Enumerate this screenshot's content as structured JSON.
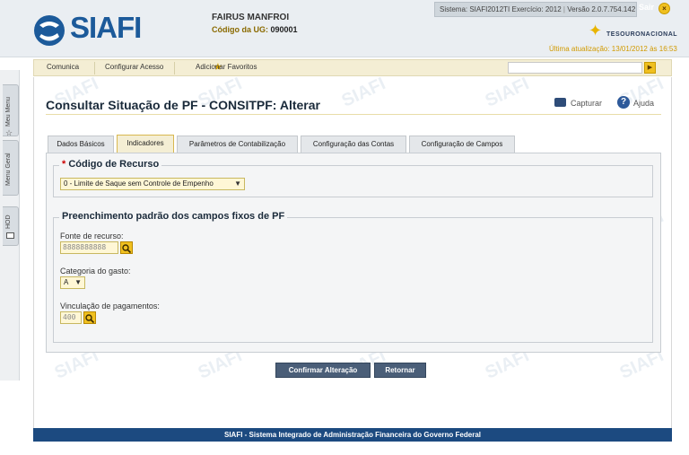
{
  "header": {
    "logo_text": "SIAFI",
    "user_name": "FAIRUS MANFROI",
    "ug_label": "Código da UG:",
    "ug_value": "090001",
    "system_label": "Sistema: SIAFI2012TI",
    "exercise_label": "Exercício: 2012",
    "version_label": "Versão",
    "version_value": "2.0.7.754.142",
    "exit_label": "Sair",
    "exit_icon": "×",
    "tesouro_label": "TESOURONACIONAL",
    "last_update": "Última atualização: 13/01/2012 às 16:53"
  },
  "nav": {
    "items": [
      "Comunica",
      "Configurar Acesso",
      "Adicionar Favoritos"
    ],
    "search_placeholder": "",
    "go_icon": "▶"
  },
  "sidebar": {
    "tabs": [
      "Meu Menu",
      "Menu Geral",
      "HOD"
    ]
  },
  "page": {
    "title": "Consultar Situação de PF - CONSITPF: Alterar",
    "capture_label": "Capturar",
    "help_label": "Ajuda",
    "help_icon": "?"
  },
  "tabs": [
    "Dados Básicos",
    "Indicadores",
    "Parâmetros de Contabilização",
    "Configuração das Contas",
    "Configuração de Campos"
  ],
  "active_tab": "Indicadores",
  "form": {
    "recurso_legend_req": "*",
    "recurso_legend": "Código de Recurso",
    "recurso_value": "0 - Limite de Saque sem Controle de Empenho",
    "preenchimento_legend": "Preenchimento padrão dos campos fixos de PF",
    "fonte_label": "Fonte de recurso:",
    "fonte_value": "8888888888",
    "categoria_label": "Categoria do gasto:",
    "categoria_value": "A",
    "vinculacao_label": "Vinculação de pagamentos:",
    "vinculacao_value": "400"
  },
  "buttons": {
    "confirm": "Confirmar Alteração",
    "back": "Retornar"
  },
  "footer": {
    "text": "SIAFI - Sistema Integrado de Administração Financeira do Governo Federal"
  },
  "watermark": "SIAFI",
  "colors": {
    "brand_blue": "#1c5a9a",
    "accent_yellow": "#f0c020",
    "footer_blue": "#1c4a80",
    "button_slate": "#4a5e78"
  }
}
